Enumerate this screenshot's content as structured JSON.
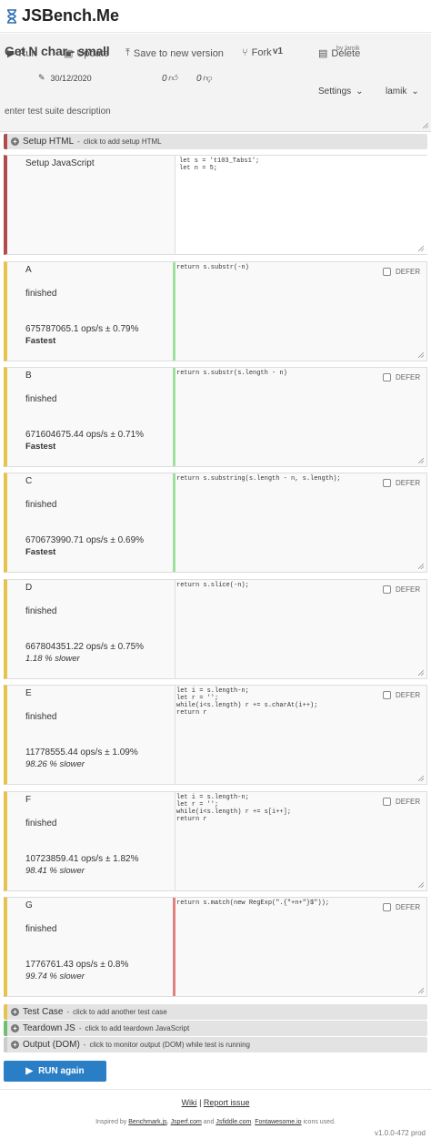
{
  "app": {
    "name": "JSBench.Me",
    "accent": "#2a7ec6"
  },
  "suite": {
    "title": "Get N char - small",
    "date": "30/12/2020",
    "likes": "0",
    "dislikes": "0",
    "version": "v1",
    "username_small": "by lamik",
    "description_placeholder": "enter test suite description"
  },
  "toolbar": {
    "run": "Run",
    "update": "Update",
    "save_new": "Save to new version",
    "fork": "Fork",
    "delete": "Delete"
  },
  "user_menu": {
    "settings": "Settings",
    "user": "lamik"
  },
  "setup_html": {
    "label": "Setup HTML",
    "hint": "click to add setup HTML"
  },
  "setup_js": {
    "label": "Setup JavaScript",
    "code": "let s = 't103_Tabs1';\nlet n = 5;"
  },
  "defer_label": "DEFER",
  "cases": [
    {
      "name": "A",
      "status": "finished",
      "result": "675787065.1 ops/s ± 0.79%",
      "rank": "Fastest",
      "fastest": true,
      "code": "return s.substr(-n)"
    },
    {
      "name": "B",
      "status": "finished",
      "result": "671604675.44 ops/s ± 0.71%",
      "rank": "Fastest",
      "fastest": true,
      "code": "return s.substr(s.length - n)"
    },
    {
      "name": "C",
      "status": "finished",
      "result": "670673990.71 ops/s ± 0.69%",
      "rank": "Fastest",
      "fastest": true,
      "code": "return s.substring(s.length - n, s.length);"
    },
    {
      "name": "D",
      "status": "finished",
      "result": "667804351.22 ops/s ± 0.75%",
      "rank": "1.18 % slower",
      "fastest": false,
      "code": "return s.slice(-n);"
    },
    {
      "name": "E",
      "status": "finished",
      "result": "11778555.44 ops/s ± 1.09%",
      "rank": "98.26 % slower",
      "fastest": false,
      "code": "let i = s.length-n;\nlet r = '';\nwhile(i<s.length) r += s.charAt(i++);\nreturn r"
    },
    {
      "name": "F",
      "status": "finished",
      "result": "10723859.41 ops/s ± 1.82%",
      "rank": "98.41 % slower",
      "fastest": false,
      "code": "let i = s.length-n;\nlet r = '';\nwhile(i<s.length) r += s[i++];\nreturn r"
    },
    {
      "name": "G",
      "status": "finished",
      "result": "1776761.43 ops/s ± 0.8%",
      "rank": "99.74 % slower",
      "fastest": false,
      "slowest": true,
      "code": "return s.match(new RegExp(\".{\"+n+\"}$\"));"
    }
  ],
  "test_case_bar": {
    "label": "Test Case",
    "hint": "click to add another test case"
  },
  "teardown_bar": {
    "label": "Teardown JS",
    "hint": "click to add teardown JavaScript"
  },
  "output_bar": {
    "label": "Output (DOM)",
    "hint": "click to monitor output (DOM) while test is running"
  },
  "run_button": "RUN again",
  "footer": {
    "wiki": "Wiki",
    "sep": "|",
    "report": "Report issue",
    "inspired_prefix": "Inspired by",
    "link_benchmark": "Benchmark.js",
    "link_jsperf": "Jsperf.com",
    "and": "and",
    "link_jsfiddle": "Jsfiddle.com",
    "link_fontawesome": "Fontawesome.io",
    "inspired_suffix": "icons used.",
    "version": "v1.0.0-472 prod"
  },
  "colors": {
    "setup_border": "#b24b4b",
    "case_border": "#e5c34d",
    "teardown_border": "#6fbf73",
    "good_marker": "#9ee09e",
    "bad_marker": "#e08080"
  }
}
